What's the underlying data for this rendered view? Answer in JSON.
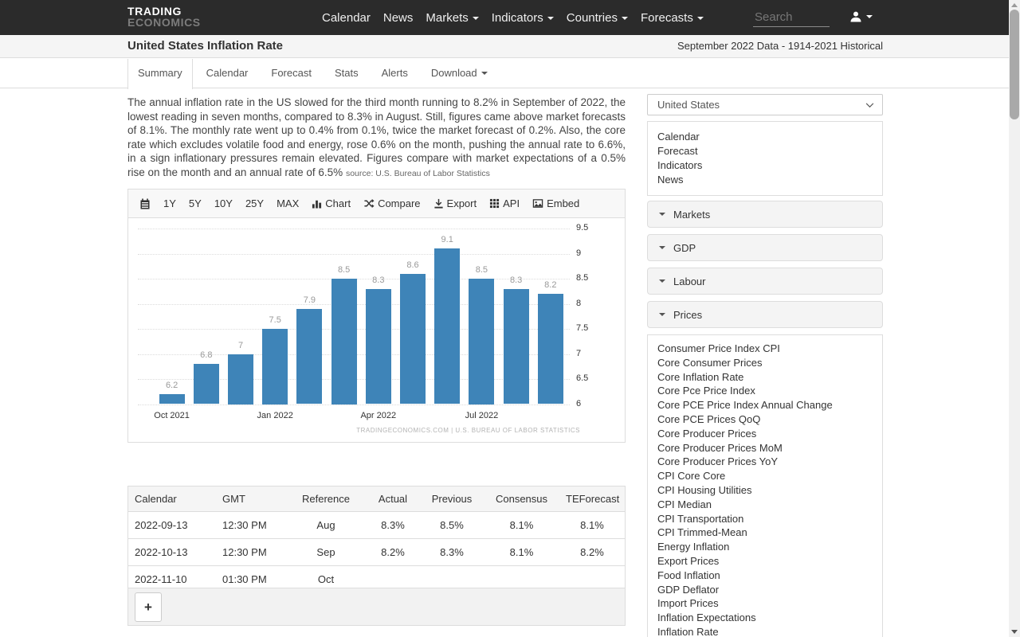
{
  "navbar": {
    "logo_top": "TRADING",
    "logo_bottom": "ECONOMICS",
    "items": [
      {
        "label": "Calendar",
        "caret": false
      },
      {
        "label": "News",
        "caret": false
      },
      {
        "label": "Markets",
        "caret": true
      },
      {
        "label": "Indicators",
        "caret": true
      },
      {
        "label": "Countries",
        "caret": true
      },
      {
        "label": "Forecasts",
        "caret": true
      }
    ],
    "search_placeholder": "Search"
  },
  "header": {
    "title": "United States Inflation Rate",
    "subtitle": "September 2022 Data - 1914-2021 Historical"
  },
  "tabs": [
    {
      "label": "Summary",
      "active": true,
      "caret": false
    },
    {
      "label": "Calendar",
      "active": false,
      "caret": false
    },
    {
      "label": "Forecast",
      "active": false,
      "caret": false
    },
    {
      "label": "Stats",
      "active": false,
      "caret": false
    },
    {
      "label": "Alerts",
      "active": false,
      "caret": false
    },
    {
      "label": "Download",
      "active": false,
      "caret": true
    }
  ],
  "summary": {
    "text": "The annual inflation rate in the US slowed for the third month running to 8.2% in September of 2022, the lowest reading in seven months, compared to 8.3% in August. Still, figures came above market forecasts of 8.1%. The monthly rate went up to 0.4% from 0.1%, twice the market forecast of 0.2%. Also, the core rate which excludes volatile food and energy, rose 0.6% on the month, pushing the annual rate to 6.6%, in a sign inflationary pressures remain elevated. Figures compare with market expectations of a 0.5% rise on the month and an annual rate of 6.5%",
    "source": "source: U.S. Bureau of Labor Statistics"
  },
  "toolbar": {
    "ranges": [
      "1Y",
      "5Y",
      "10Y",
      "25Y",
      "MAX"
    ],
    "buttons": [
      {
        "label": "Chart",
        "icon": "bar-chart-icon"
      },
      {
        "label": "Compare",
        "icon": "compare-icon"
      },
      {
        "label": "Export",
        "icon": "export-icon"
      },
      {
        "label": "API",
        "icon": "api-icon"
      },
      {
        "label": "Embed",
        "icon": "embed-icon"
      }
    ]
  },
  "chart_data": {
    "type": "bar",
    "title": "United States Inflation Rate",
    "categories": [
      "Oct 2021",
      "Nov 2021",
      "Dec 2021",
      "Jan 2022",
      "Feb 2022",
      "Mar 2022",
      "Apr 2022",
      "May 2022",
      "Jun 2022",
      "Jul 2022",
      "Aug 2022",
      "Sep 2022"
    ],
    "values": [
      6.2,
      6.8,
      7,
      7.5,
      7.9,
      8.5,
      8.3,
      8.6,
      9.1,
      8.5,
      8.3,
      8.2
    ],
    "labels": [
      "6.2",
      "6.8",
      "7",
      "7.5",
      "7.9",
      "8.5",
      "8.3",
      "8.6",
      "9.1",
      "8.5",
      "8.3",
      "8.2"
    ],
    "xlabel": "",
    "ylabel": "",
    "ylim": [
      6,
      9.5
    ],
    "y_ticks": [
      9.5,
      9,
      8.5,
      8,
      7.5,
      7,
      6.5,
      6
    ],
    "x_ticks": [
      {
        "label": "Oct 2021",
        "index": 0
      },
      {
        "label": "Jan 2022",
        "index": 3
      },
      {
        "label": "Apr 2022",
        "index": 6
      },
      {
        "label": "Jul 2022",
        "index": 9
      }
    ],
    "grid": true,
    "legend": false,
    "bar_color": "#3e84b8",
    "value_label_color": "#999999",
    "watermark": "TRADINGECONOMICS.COM  |  U.S. BUREAU OF LABOR STATISTICS"
  },
  "table": {
    "headers": [
      "Calendar",
      "GMT",
      "Reference",
      "Actual",
      "Previous",
      "Consensus",
      "TEForecast"
    ],
    "rows": [
      [
        "2022-09-13",
        "12:30 PM",
        "Aug",
        "8.3%",
        "8.5%",
        "8.1%",
        "8.1%"
      ],
      [
        "2022-10-13",
        "12:30 PM",
        "Sep",
        "8.2%",
        "8.3%",
        "8.1%",
        "8.2%"
      ],
      [
        "2022-11-10",
        "01:30 PM",
        "Oct",
        "",
        "",
        "",
        ""
      ]
    ],
    "add_button": "+"
  },
  "sidebar": {
    "country_select": "United States",
    "quick_links": [
      "Calendar",
      "Forecast",
      "Indicators",
      "News"
    ],
    "sections": [
      "Markets",
      "GDP",
      "Labour",
      "Prices"
    ],
    "price_links": [
      "Consumer Price Index CPI",
      "Core Consumer Prices",
      "Core Inflation Rate",
      "Core Pce Price Index",
      "Core PCE Price Index Annual Change",
      "Core PCE Prices QoQ",
      "Core Producer Prices",
      "Core Producer Prices MoM",
      "Core Producer Prices YoY",
      "CPI Core Core",
      "CPI Housing Utilities",
      "CPI Median",
      "CPI Transportation",
      "CPI Trimmed-Mean",
      "Energy Inflation",
      "Export Prices",
      "Food Inflation",
      "GDP Deflator",
      "Import Prices",
      "Inflation Expectations",
      "Inflation Rate"
    ]
  },
  "colors": {
    "navbar_bg": "#2b2b2b",
    "bar_color": "#3e84b8",
    "panel_bg": "#f4f4f4"
  }
}
